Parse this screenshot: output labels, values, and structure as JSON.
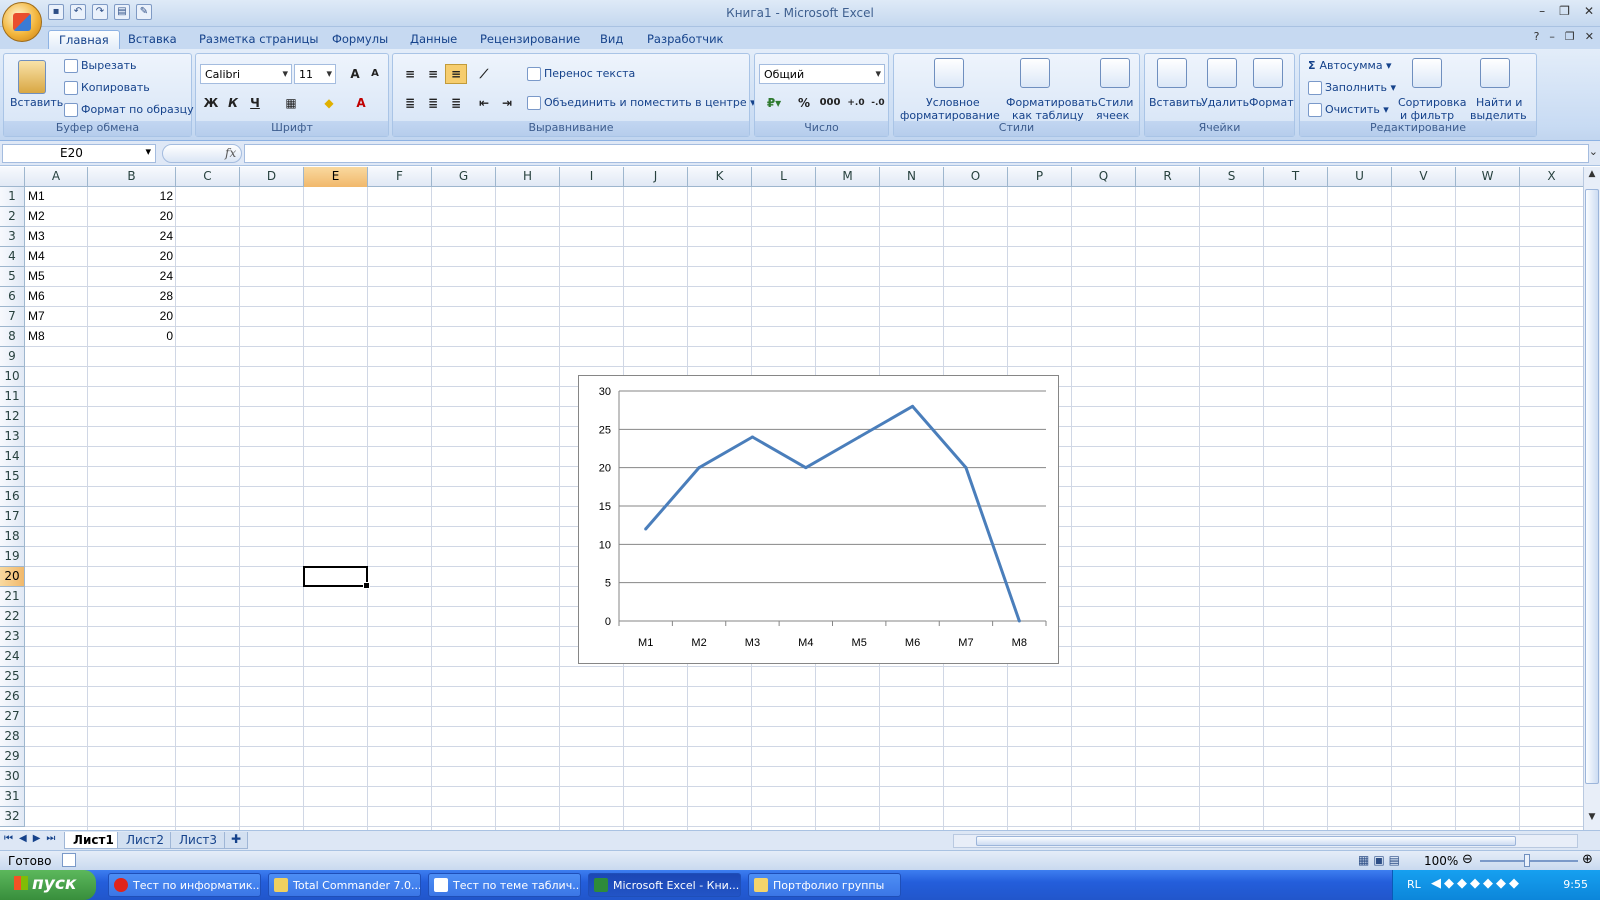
{
  "window": {
    "title": "Книга1 - Microsoft Excel"
  },
  "ribbon_tabs": [
    "Главная",
    "Вставка",
    "Разметка страницы",
    "Формулы",
    "Данные",
    "Рецензирование",
    "Вид",
    "Разработчик"
  ],
  "clipboard": {
    "paste": "Вставить",
    "cut": "Вырезать",
    "copy": "Копировать",
    "format_painter": "Формат по образцу",
    "label": "Буфер обмена"
  },
  "font": {
    "name": "Calibri",
    "size": "11",
    "label": "Шрифт",
    "bold": "Ж",
    "italic": "К",
    "underline": "Ч"
  },
  "alignment": {
    "wrap": "Перенос текста",
    "merge": "Объединить и поместить в центре",
    "label": "Выравнивание"
  },
  "number": {
    "format": "Общий",
    "percent": "%",
    "thousands": "000",
    "label": "Число"
  },
  "styles": {
    "conditional_1": "Условное",
    "conditional_2": "форматирование",
    "table_1": "Форматировать",
    "table_2": "как таблицу",
    "cell_1": "Стили",
    "cell_2": "ячеек",
    "label": "Стили"
  },
  "cells": {
    "insert": "Вставить",
    "delete": "Удалить",
    "format": "Формат",
    "label": "Ячейки"
  },
  "editing": {
    "autosum": "Автосумма",
    "fill": "Заполнить",
    "clear": "Очистить",
    "sort_1": "Сортировка",
    "sort_2": "и фильтр",
    "find_1": "Найти и",
    "find_2": "выделить",
    "label": "Редактирование"
  },
  "formula_bar": {
    "name_box": "E20",
    "fx": "fx",
    "value": ""
  },
  "columns": [
    "A",
    "B",
    "C",
    "D",
    "E",
    "F",
    "G",
    "H",
    "I",
    "J",
    "K",
    "L",
    "M",
    "N",
    "O",
    "P",
    "Q",
    "R",
    "S",
    "T",
    "U",
    "V",
    "W",
    "X"
  ],
  "rows": [
    "1",
    "2",
    "3",
    "4",
    "5",
    "6",
    "7",
    "8",
    "9",
    "10",
    "11",
    "12",
    "13",
    "14",
    "15",
    "16",
    "17",
    "18",
    "19",
    "20",
    "21",
    "22",
    "23",
    "24",
    "25",
    "26",
    "27",
    "28",
    "29",
    "30",
    "31",
    "32"
  ],
  "selected": {
    "col": "E",
    "row": "20"
  },
  "cell_data": [
    {
      "a": "M1",
      "b": "12"
    },
    {
      "a": "M2",
      "b": "20"
    },
    {
      "a": "M3",
      "b": "24"
    },
    {
      "a": "M4",
      "b": "20"
    },
    {
      "a": "M5",
      "b": "24"
    },
    {
      "a": "M6",
      "b": "28"
    },
    {
      "a": "M7",
      "b": "20"
    },
    {
      "a": "M8",
      "b": "0"
    }
  ],
  "chart_data": {
    "type": "line",
    "categories": [
      "M1",
      "M2",
      "M3",
      "M4",
      "M5",
      "M6",
      "M7",
      "M8"
    ],
    "series": [
      {
        "values": [
          12,
          20,
          24,
          20,
          24,
          28,
          20,
          0
        ],
        "color": "#4a7ebb"
      }
    ],
    "ylim": [
      0,
      30
    ],
    "yticks": [
      "0",
      "5",
      "10",
      "15",
      "20",
      "25",
      "30"
    ],
    "grid": true
  },
  "sheets": [
    "Лист1",
    "Лист2",
    "Лист3"
  ],
  "status": {
    "ready": "Готово",
    "zoom": "100%"
  },
  "taskbar": {
    "start": "пуск",
    "tasks": [
      "Тест по информатик...",
      "Total Commander 7.0...",
      "Тест по теме таблич...",
      "Microsoft Excel - Кни...",
      "Портфолио группы"
    ],
    "lang": "RL",
    "time": "9:55"
  }
}
